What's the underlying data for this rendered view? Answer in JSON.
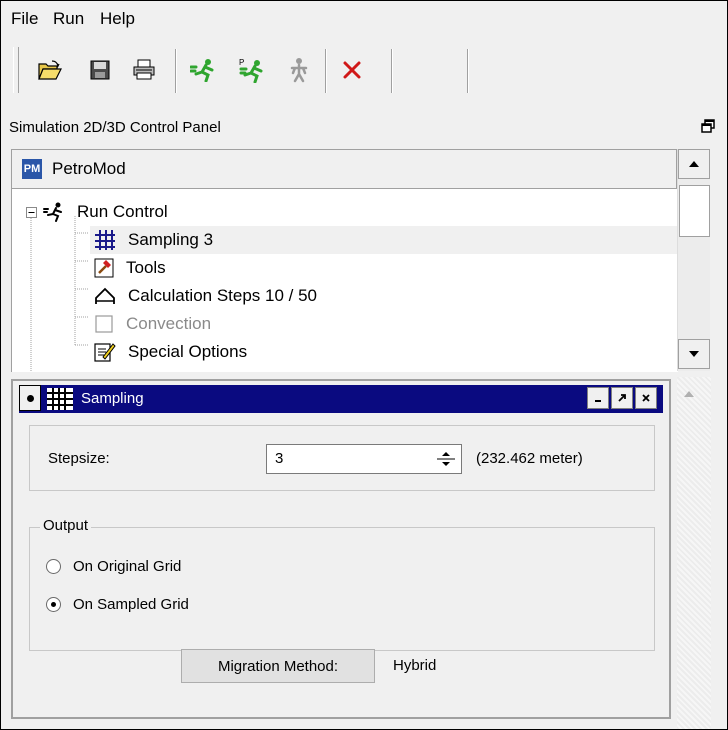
{
  "menu": {
    "items": [
      "File",
      "Run",
      "Help"
    ]
  },
  "toolbar": {
    "buttons": [
      "open-folder-icon",
      "save-disk-icon",
      "print-icon",
      "run-icon",
      "run-parallel-icon",
      "stop-run-icon",
      "cancel-x-icon"
    ]
  },
  "panel": {
    "title": "Simulation 2D/3D Control Panel"
  },
  "tree": {
    "root": {
      "logo": "PM",
      "label": "PetroMod"
    },
    "run_control": "Run Control",
    "items": [
      {
        "label": "Sampling 3",
        "icon": "grid-icon",
        "enabled": true
      },
      {
        "label": "Tools",
        "icon": "hammer-icon",
        "enabled": true
      },
      {
        "label": "Calculation Steps 10 / 50",
        "icon": "steps-icon",
        "enabled": true
      },
      {
        "label": "Convection",
        "icon": "empty-box-icon",
        "enabled": false
      },
      {
        "label": "Special Options",
        "icon": "edit-note-icon",
        "enabled": true
      }
    ]
  },
  "sampling": {
    "title": "Sampling",
    "stepsize_label": "Stepsize:",
    "stepsize_value": "3",
    "stepsize_unit": "(232.462 meter)",
    "output_legend": "Output",
    "options": [
      {
        "label": "On Original Grid",
        "selected": false
      },
      {
        "label": "On Sampled Grid",
        "selected": true
      }
    ]
  },
  "migration": {
    "button_label": "Migration Method:",
    "value": "Hybrid"
  },
  "colors": {
    "title_bar": "#0a0a80",
    "logo": "#2a56a8",
    "run_green": "#2fa52f",
    "cancel_red": "#d01818"
  }
}
